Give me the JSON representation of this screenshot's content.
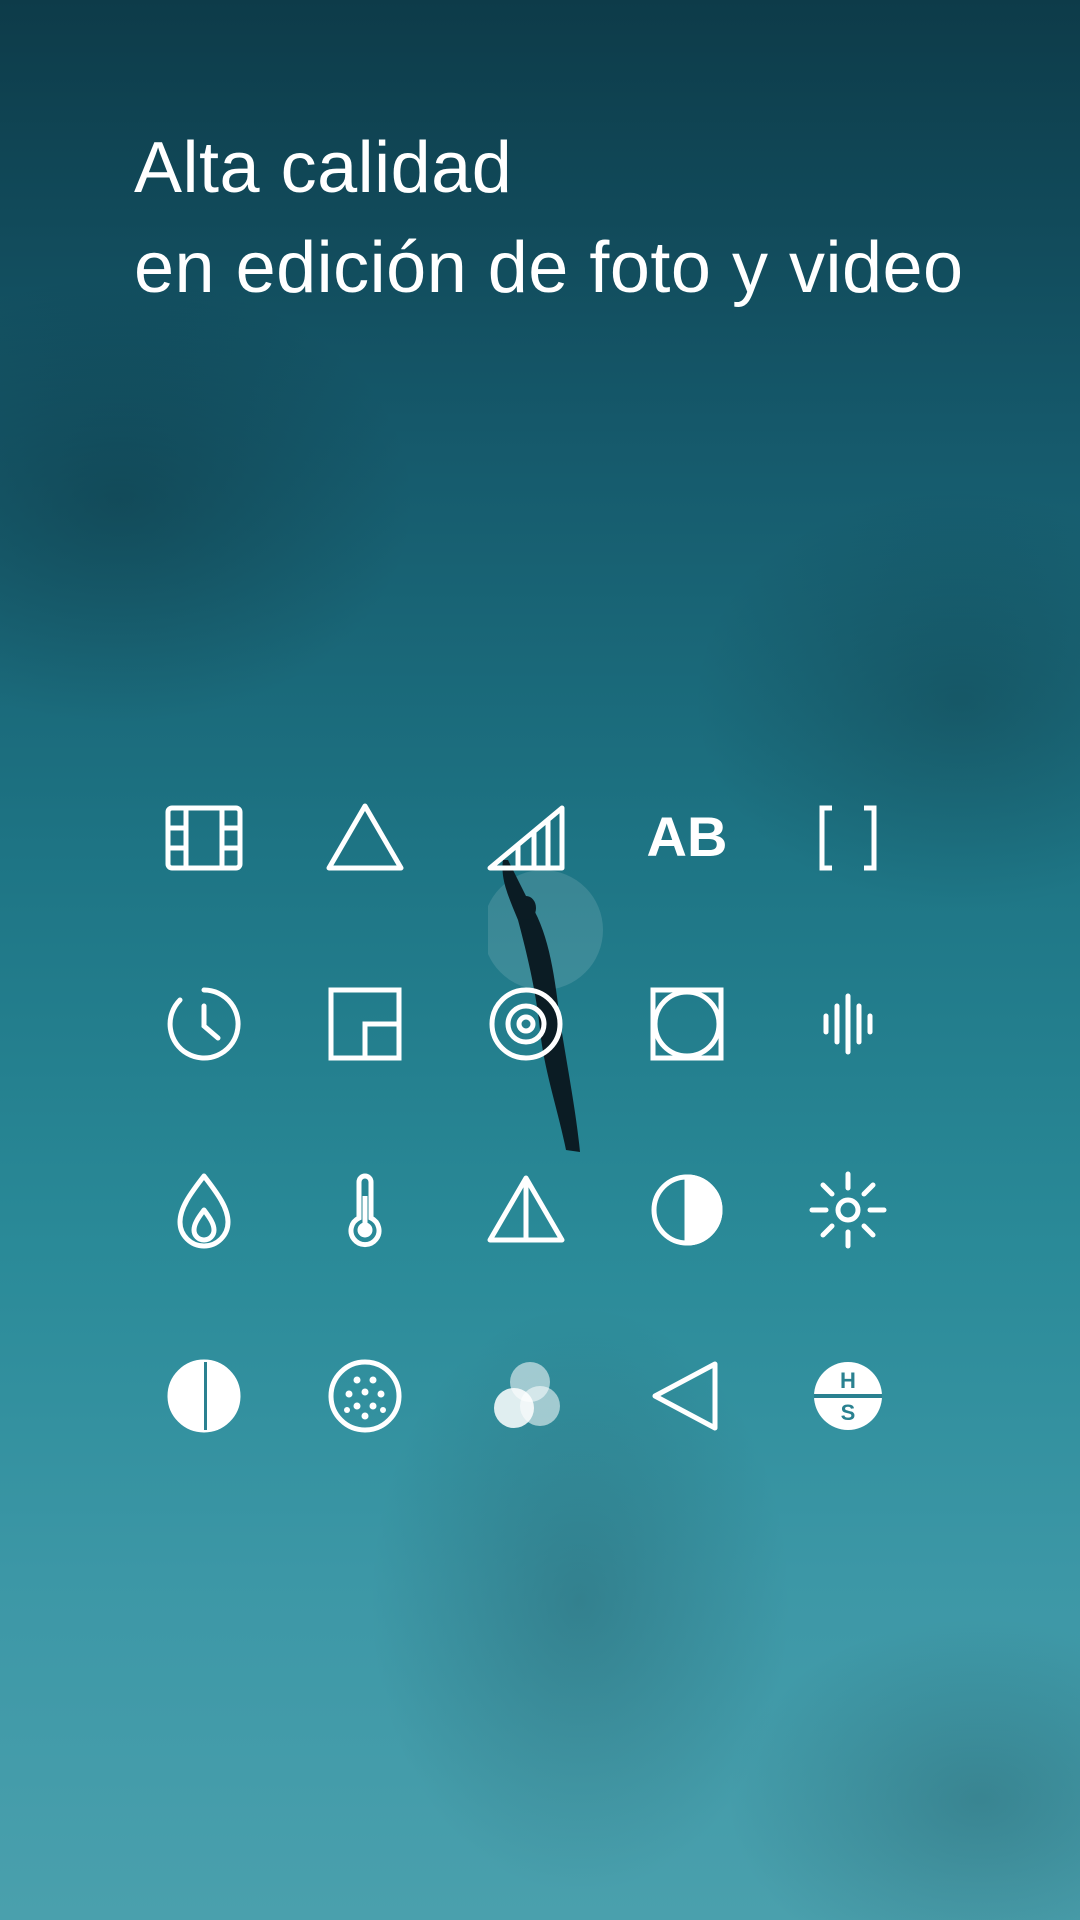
{
  "headline": {
    "line1": "Alta calidad",
    "line2": "en edición de foto y video"
  },
  "colors": {
    "text": "#ffffff",
    "ocean_dark": "#0d3b49",
    "ocean_light": "#4aa0ad"
  },
  "tool_icons": [
    {
      "name": "film-icon"
    },
    {
      "name": "triangle-icon"
    },
    {
      "name": "signal-bars-icon"
    },
    {
      "name": "ab-text-icon",
      "label": "AB"
    },
    {
      "name": "brackets-icon"
    },
    {
      "name": "clock-icon"
    },
    {
      "name": "frame-icon"
    },
    {
      "name": "target-icon"
    },
    {
      "name": "vignette-square-icon"
    },
    {
      "name": "audio-wave-icon"
    },
    {
      "name": "flame-drop-icon"
    },
    {
      "name": "thermometer-icon"
    },
    {
      "name": "split-triangle-icon"
    },
    {
      "name": "contrast-icon"
    },
    {
      "name": "sun-icon"
    },
    {
      "name": "tone-circle-icon"
    },
    {
      "name": "grain-icon"
    },
    {
      "name": "color-circles-icon"
    },
    {
      "name": "play-left-triangle-icon"
    },
    {
      "name": "hs-badge-icon",
      "label_top": "H",
      "label_bottom": "S"
    }
  ]
}
